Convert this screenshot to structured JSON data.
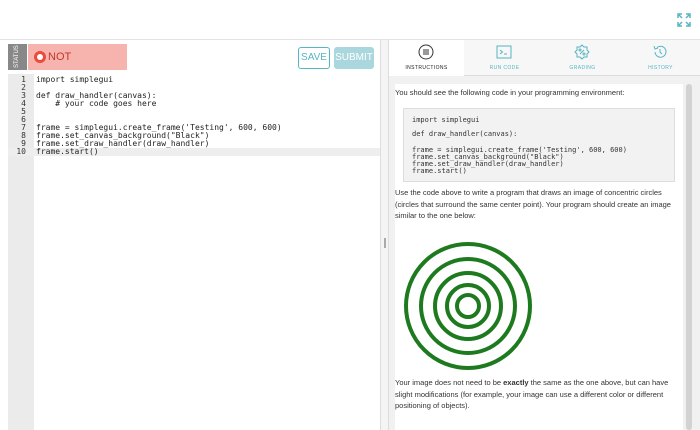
{
  "topbar": {
    "expand_icon": "expand-icon"
  },
  "status": {
    "tag": "STATUS",
    "label": "NOT SUBMITTED",
    "color": "#e74c3c"
  },
  "actions": {
    "save": "SAVE",
    "submit": "SUBMIT"
  },
  "editor": {
    "lines": [
      {
        "n": "1",
        "text": "import simplegui"
      },
      {
        "n": "2",
        "text": ""
      },
      {
        "n": "3",
        "text": "def draw_handler(canvas):"
      },
      {
        "n": "4",
        "text": "    # your code goes here"
      },
      {
        "n": "5",
        "text": ""
      },
      {
        "n": "6",
        "text": ""
      },
      {
        "n": "7",
        "text": "frame = simplegui.create_frame('Testing', 600, 600)"
      },
      {
        "n": "8",
        "text": "frame.set_canvas_background(\"Black\")"
      },
      {
        "n": "9",
        "text": "frame.set_draw_handler(draw_handler)"
      },
      {
        "n": "10",
        "text": "frame.start()"
      }
    ]
  },
  "tabs": [
    {
      "label": "INSTRUCTIONS",
      "icon": "list-icon"
    },
    {
      "label": "RUN CODE",
      "icon": "terminal-icon"
    },
    {
      "label": "GRADING",
      "icon": "percent-icon"
    },
    {
      "label": "HISTORY",
      "icon": "history-icon"
    }
  ],
  "instructions": {
    "intro": "You should see the following code in your programming environment:",
    "code": [
      "import simplegui",
      "def draw_handler(canvas):",
      "frame = simplegui.create_frame('Testing', 600, 600)",
      "frame.set_canvas_background(\"Black\")",
      "frame.set_draw_handler(draw_handler)",
      "frame.start()"
    ],
    "task": "Use the code above to write a program that draws an image of concentric circles (circles that surround the same center point). Your program should create an image similar to the one below:",
    "note_before": "Your image does not need to be ",
    "note_bold": "exactly",
    "note_after": " the same as the one above, but can have slight modifications (for example, your image can use a different color or different positioning of objects).",
    "circle_color": "#1e7a1e"
  }
}
